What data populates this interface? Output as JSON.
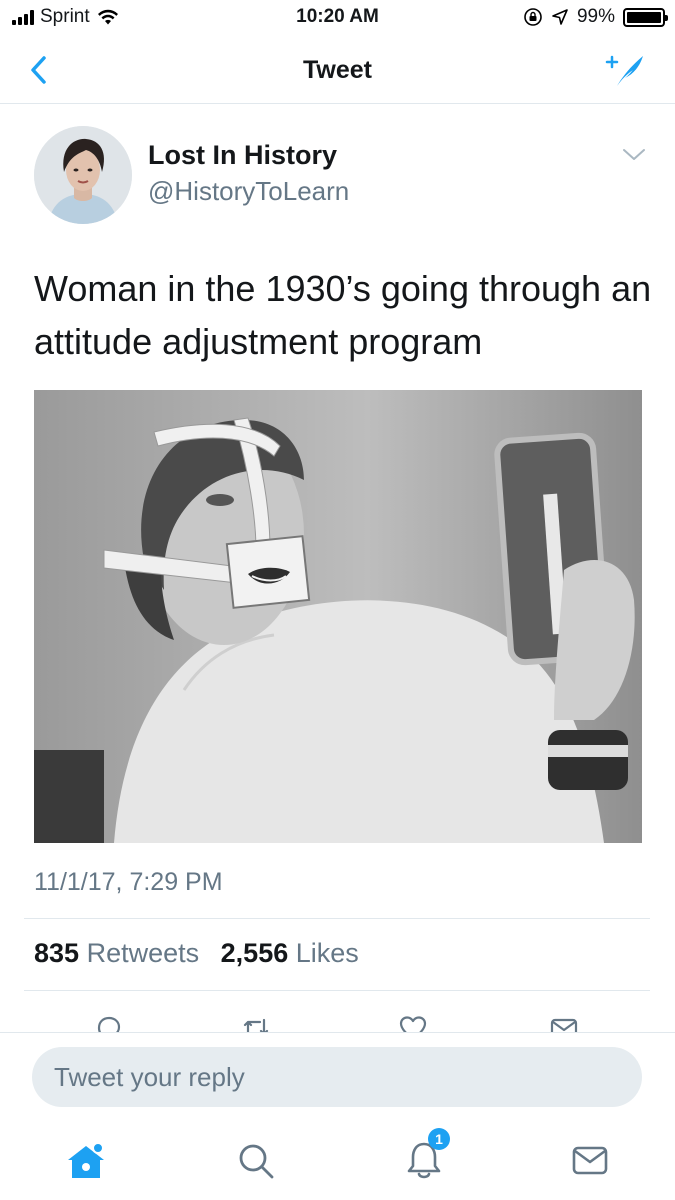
{
  "status_bar": {
    "carrier": "Sprint",
    "time": "10:20 AM",
    "battery": "99%",
    "battery_level": 0.99,
    "icons": [
      "signal-icon",
      "wifi-icon",
      "rotation-lock-icon",
      "location-icon",
      "battery-icon"
    ]
  },
  "nav": {
    "title": "Tweet",
    "back_icon": "chevron-left-icon",
    "compose_icon": "compose-tweet-icon"
  },
  "tweet": {
    "author_name": "Lost In History",
    "author_handle": "@HistoryToLearn",
    "text": "Woman in the 1930’s going through an attitude adjustment program",
    "timestamp": "11/1/17, 7:29 PM",
    "retweets_count": "835",
    "retweets_label": "Retweets",
    "likes_count": "2,556",
    "likes_label": "Likes"
  },
  "actions": [
    "reply-icon",
    "retweet-icon",
    "like-icon",
    "direct-message-icon"
  ],
  "reply": {
    "placeholder": "Tweet your reply"
  },
  "tab_bar": {
    "items": [
      "home-icon",
      "search-icon",
      "notifications-icon",
      "messages-icon"
    ],
    "notifications_badge": "1"
  },
  "colors": {
    "accent": "#1da1f2",
    "text": "#14171a",
    "secondary_text": "#657786",
    "divider": "#e1e8ed",
    "input_bg": "#e6ecf0"
  }
}
